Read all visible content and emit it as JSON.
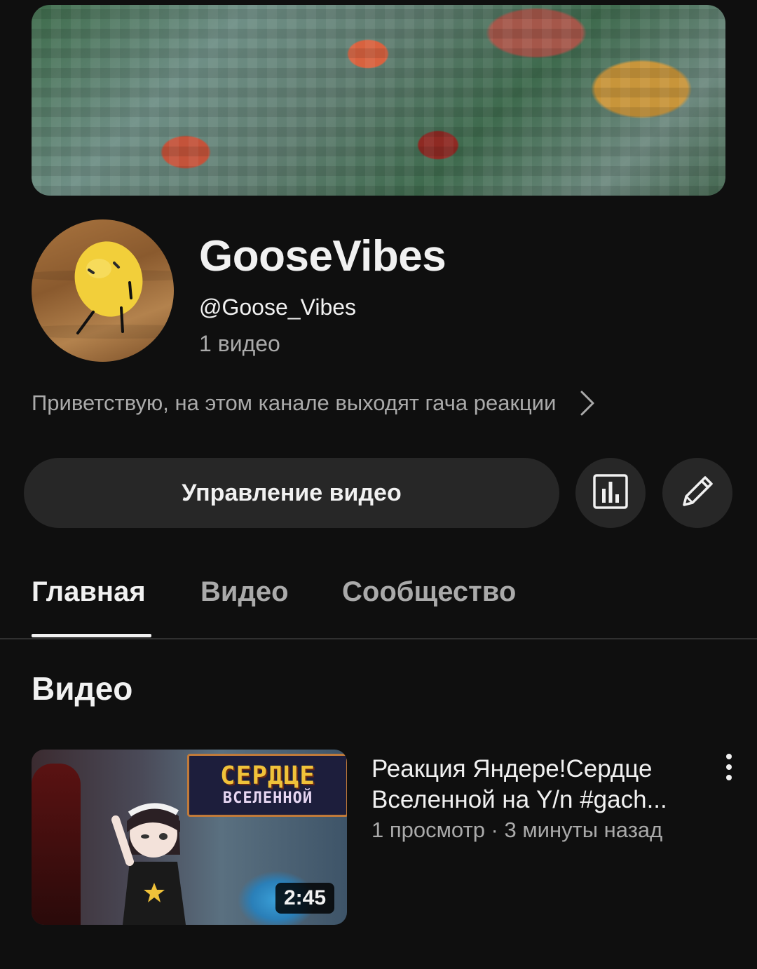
{
  "channel": {
    "name": "GooseVibes",
    "handle": "@Goose_Vibes",
    "video_count": "1 видео",
    "description": "Приветствую, на этом канале выходят гача реакции"
  },
  "actions": {
    "manage_label": "Управление видео",
    "stats_icon": "bar-chart-icon",
    "edit_icon": "pencil-icon"
  },
  "tabs": [
    {
      "label": "Главная",
      "active": true
    },
    {
      "label": "Видео",
      "active": false
    },
    {
      "label": "Сообщество",
      "active": false
    }
  ],
  "section": {
    "title": "Видео"
  },
  "videos": [
    {
      "title": "Реакция Яндере!Сердце Вселенной на Y/n #gach...",
      "meta": "1 просмотр · 3 минуты назад",
      "duration": "2:45",
      "thumb_text_1": "СЕРДЦЕ",
      "thumb_text_2": "ВСЕЛЕННОЙ"
    }
  ],
  "colors": {
    "background": "#0f0f0f",
    "button": "#272727",
    "text_primary": "#f1f1f1",
    "text_secondary": "#aaaaaa"
  }
}
